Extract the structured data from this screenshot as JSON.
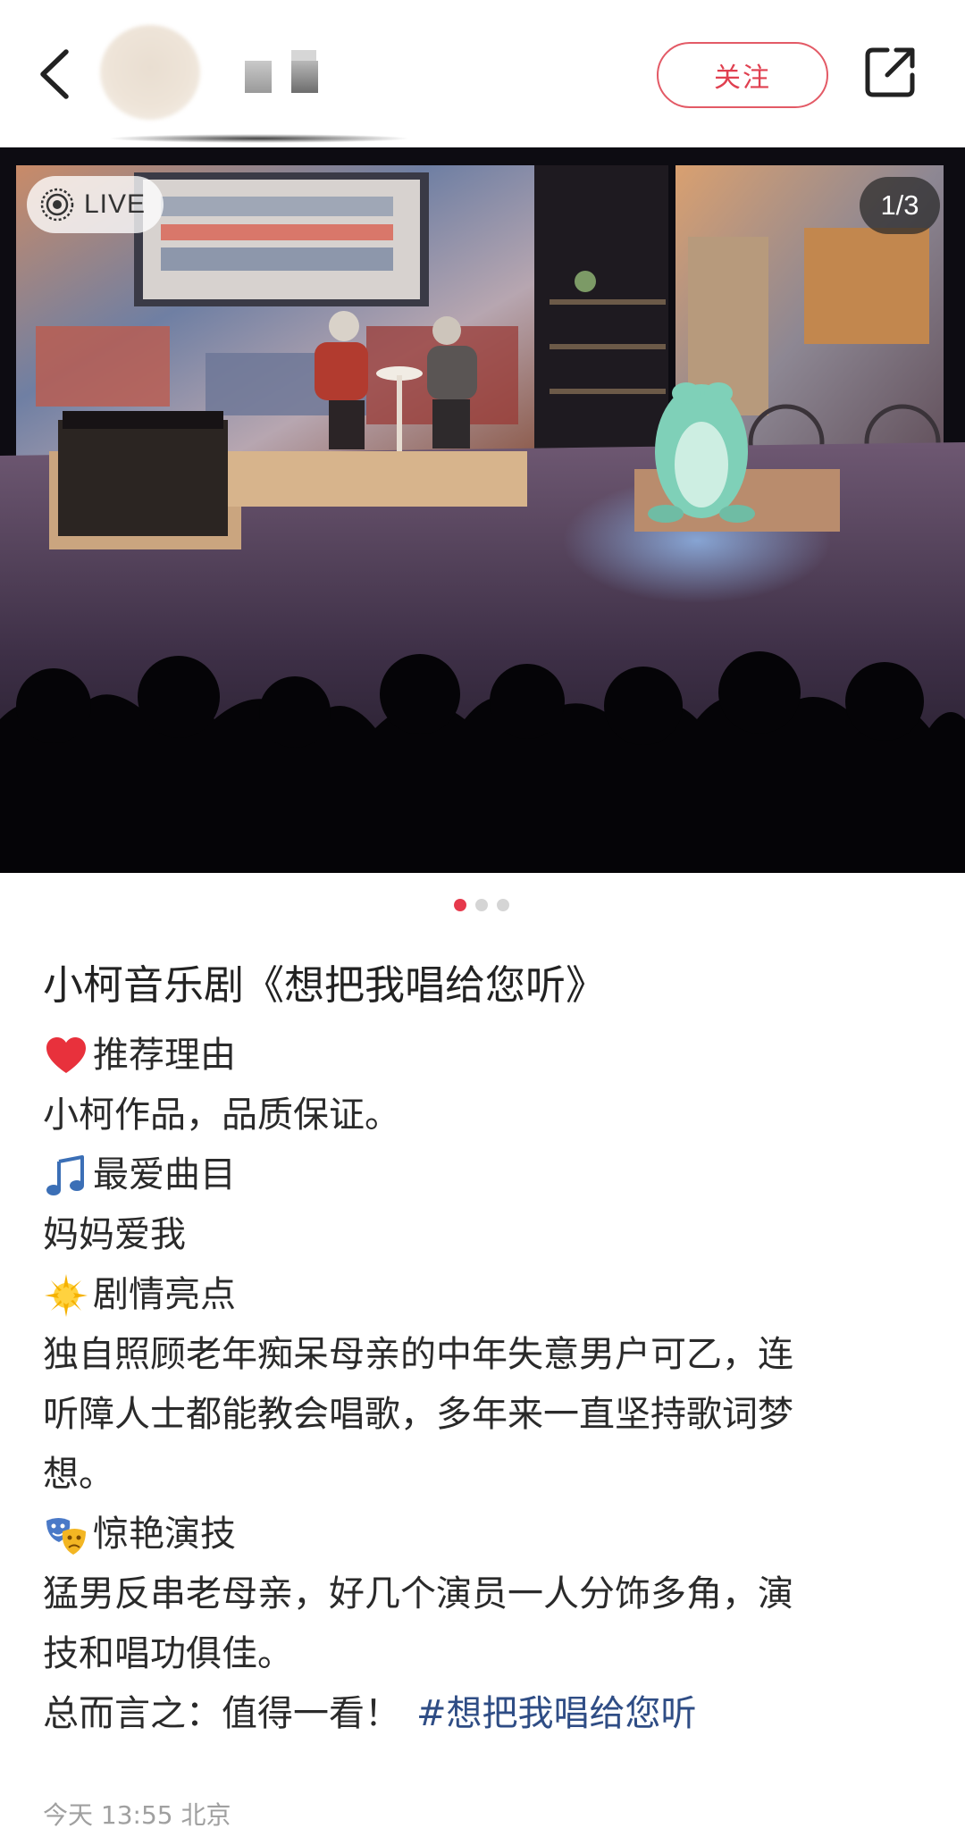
{
  "header": {
    "follow_label": "关注",
    "icons": [
      "back-arrow-icon",
      "share-icon"
    ]
  },
  "photo": {
    "live_label": "LIVE",
    "counter": "1/3",
    "image_count": 3,
    "current_index": 1
  },
  "colors": {
    "accent": "#e6394c",
    "hashtag": "#2f4d85",
    "meta": "#a0a0a0"
  },
  "post": {
    "title": "小柯音乐剧《想把我唱给您听》",
    "lines": [
      {
        "icon": "heart-icon",
        "text": "推荐理由"
      },
      {
        "text": "小柯作品，品质保证。"
      },
      {
        "icon": "musical-note-icon",
        "text": "最爱曲目"
      },
      {
        "text": "妈妈爱我"
      },
      {
        "icon": "star-icon",
        "text": "剧情亮点"
      },
      {
        "text": "独自照顾老年痴呆母亲的中年失意男户可乙，连"
      },
      {
        "text": "听障人士都能教会唱歌，多年来一直坚持歌词梦"
      },
      {
        "text": "想。"
      },
      {
        "icon": "theater-masks-icon",
        "text": "惊艳演技"
      },
      {
        "text": "猛男反串老母亲，好几个演员一人分饰多角，演"
      },
      {
        "text": "技和唱功俱佳。"
      }
    ],
    "summary": "总而言之：值得一看！",
    "hashtag": "#想把我唱给您听",
    "meta": "今天 13:55 北京"
  }
}
